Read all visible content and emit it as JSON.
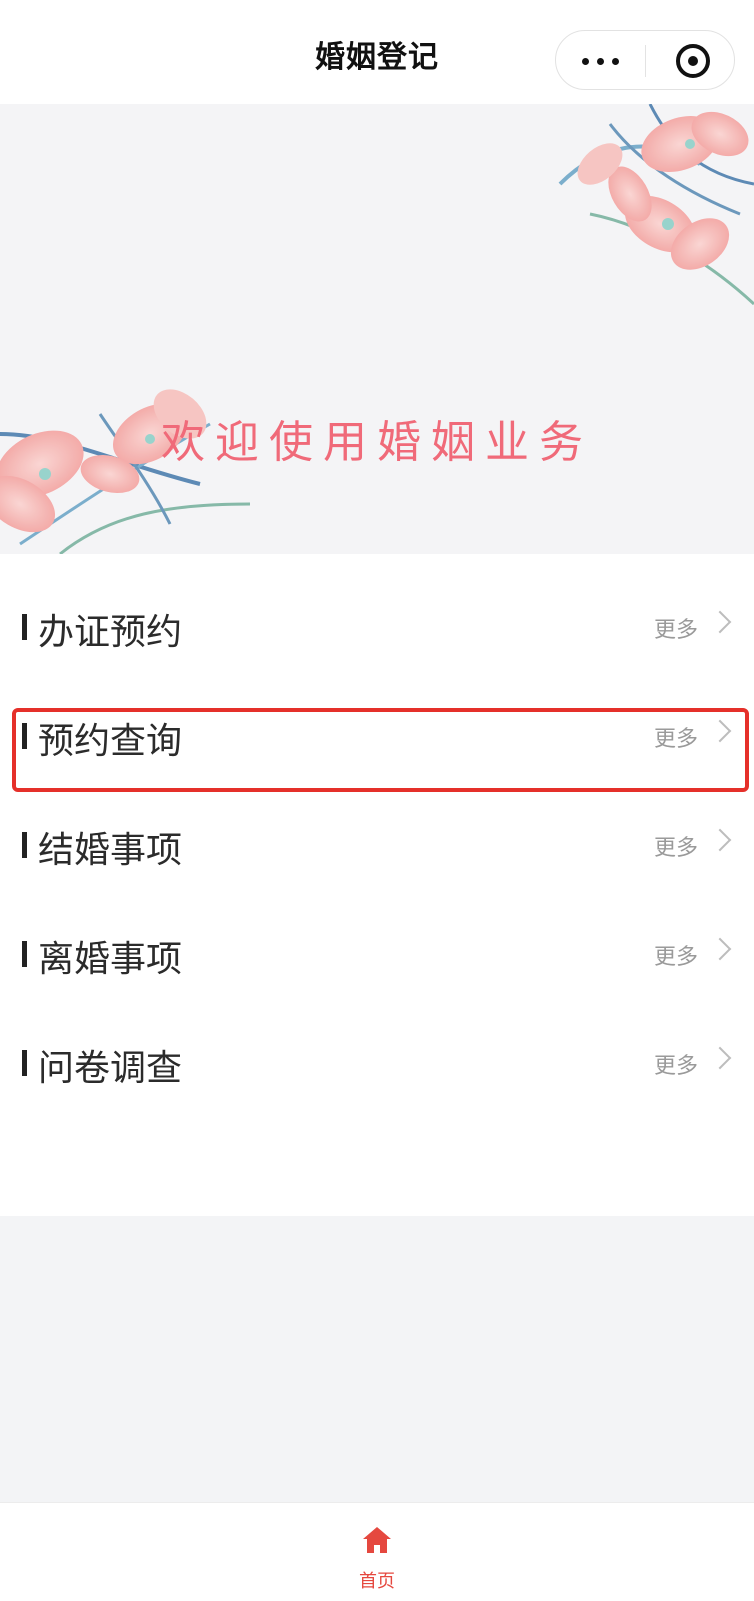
{
  "nav": {
    "title": "婚姻登记"
  },
  "banner": {
    "text": "欢迎使用婚姻业务"
  },
  "menu": [
    {
      "label": "办证预约",
      "more": "更多"
    },
    {
      "label": "预约查询",
      "more": "更多"
    },
    {
      "label": "结婚事项",
      "more": "更多"
    },
    {
      "label": "离婚事项",
      "more": "更多"
    },
    {
      "label": "问卷调查",
      "more": "更多"
    }
  ],
  "tabbar": {
    "home_label": "首页"
  },
  "colors": {
    "accent": "#e5483f",
    "highlight_border": "#e5302a",
    "banner_text": "#f06a79"
  },
  "icons": [
    "more-dots-icon",
    "target-icon",
    "chevron-right-icon",
    "home-icon"
  ]
}
